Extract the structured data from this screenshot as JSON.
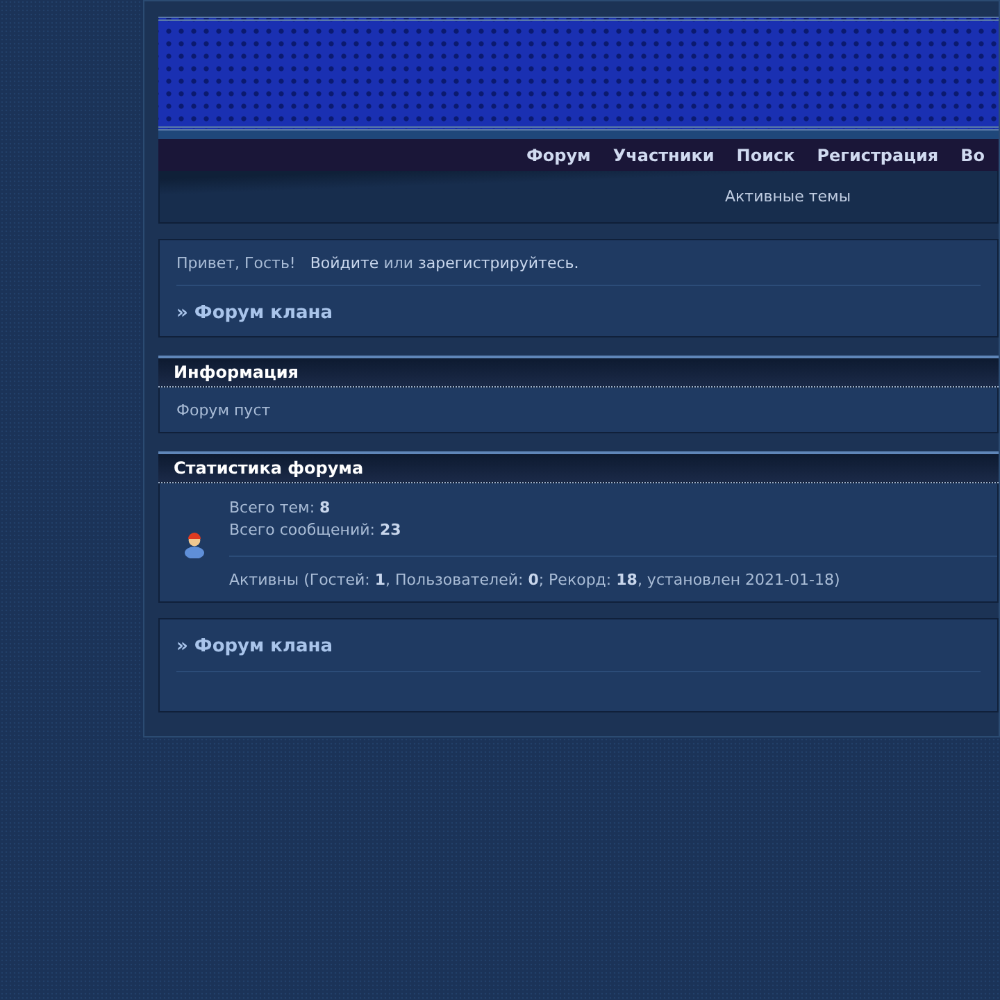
{
  "nav": {
    "items": [
      "Форум",
      "Участники",
      "Поиск",
      "Регистрация",
      "Во"
    ],
    "sub_link": "Активные темы"
  },
  "welcome": {
    "greeting": "Привет, Гость!",
    "login_link": "Войдите",
    "separator": "или",
    "register_link": "зарегистрируйтесь.",
    "category": "» Форум клана"
  },
  "info": {
    "title": "Информация",
    "text": "Форум пуст"
  },
  "stats": {
    "title": "Статистика форума",
    "lines": [
      "Всего тем: **8**",
      "Всего сообщений: **23**"
    ],
    "active": "Активны (Гостей: **1**, Пользователей: **0**; Рекорд: **18**, установлен 2021-01-18)"
  },
  "footer": {
    "category": "» Форум клана"
  }
}
